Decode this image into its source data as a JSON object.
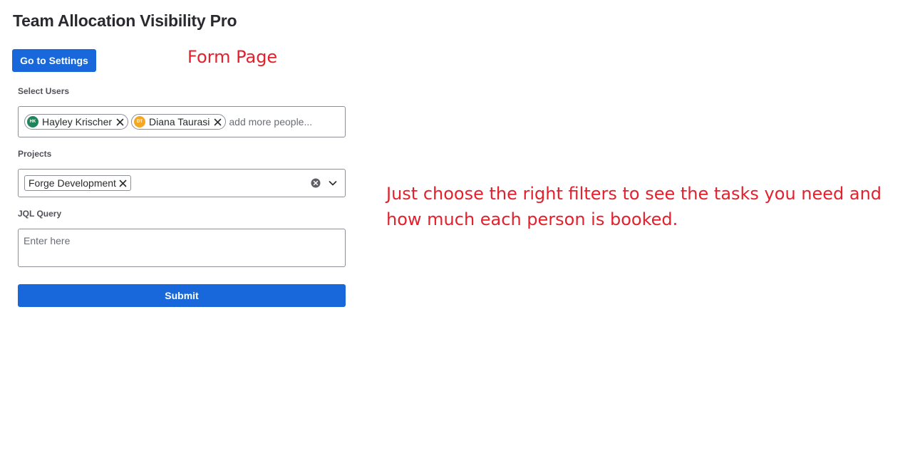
{
  "app": {
    "title": "Team Allocation Visibility Pro"
  },
  "toolbar": {
    "settings_label": "Go to Settings"
  },
  "annotations": {
    "form_page": "Form Page",
    "help_text": "Just choose the right filters to see the tasks you need and how much each person is booked.",
    "color": "#e3212d"
  },
  "form": {
    "users": {
      "label": "Select Users",
      "placeholder": "add more people...",
      "selected": [
        {
          "initials": "HK",
          "name": "Hayley Krischer",
          "avatar_color": "#1f845a",
          "icon": "close-icon"
        },
        {
          "initials": "DT",
          "name": "Diana Taurasi",
          "avatar_color": "#f5a623",
          "icon": "close-icon"
        }
      ]
    },
    "projects": {
      "label": "Projects",
      "selected": [
        {
          "name": "Forge Development",
          "icon": "close-icon"
        }
      ],
      "clear_icon": "clear-circle-icon",
      "dropdown_icon": "chevron-down-icon"
    },
    "jql": {
      "label": "JQL Query",
      "placeholder": "Enter here",
      "value": ""
    },
    "submit_label": "Submit"
  },
  "colors": {
    "primary_button": "#1868db",
    "annotation": "#e3212d"
  }
}
